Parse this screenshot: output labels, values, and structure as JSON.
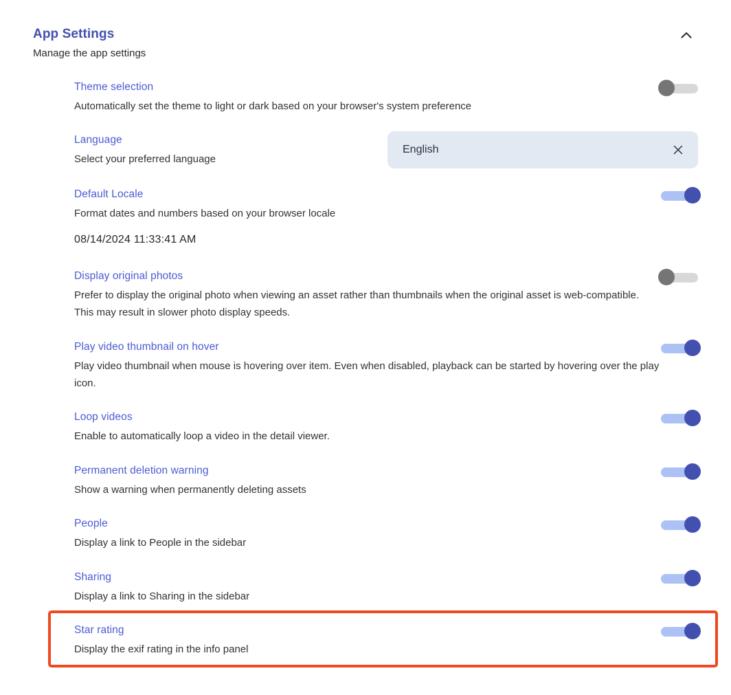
{
  "header": {
    "title": "App Settings",
    "subtitle": "Manage the app settings",
    "collapse_icon": "chevron-up-icon",
    "title_color": "#4250af"
  },
  "colors": {
    "label": "#4b5bd4",
    "description": "#323232",
    "toggle_on_track": "#adc1f5",
    "toggle_on_knob": "#4250af",
    "toggle_off_track": "#d8d8d8",
    "toggle_off_knob": "#757575",
    "select_background": "#e3e9f2",
    "highlight_border": "#f0481f"
  },
  "language_select": {
    "value": "English",
    "clear_icon": "close-icon"
  },
  "settings": [
    {
      "label": "Theme selection",
      "description": "Automatically set the theme to light or dark based on your browser's system preference",
      "control": "toggle",
      "state": "off"
    },
    {
      "label": "Language",
      "description": "Select your preferred language",
      "control": "select",
      "state": "English"
    },
    {
      "label": "Default Locale",
      "description": "Format dates and numbers based on your browser locale",
      "extra": "08/14/2024 11:33:41 AM",
      "control": "toggle",
      "state": "on"
    },
    {
      "label": "Display original photos",
      "description": "Prefer to display the original photo when viewing an asset rather than thumbnails when the original asset is web-compatible. This may result in slower photo display speeds.",
      "control": "toggle",
      "state": "off"
    },
    {
      "label": "Play video thumbnail on hover",
      "description": "Play video thumbnail when mouse is hovering over item. Even when disabled, playback can be started by hovering over the play icon.",
      "control": "toggle",
      "state": "on"
    },
    {
      "label": "Loop videos",
      "description": "Enable to automatically loop a video in the detail viewer.",
      "control": "toggle",
      "state": "on"
    },
    {
      "label": "Permanent deletion warning",
      "description": "Show a warning when permanently deleting assets",
      "control": "toggle",
      "state": "on"
    },
    {
      "label": "People",
      "description": "Display a link to People in the sidebar",
      "control": "toggle",
      "state": "on"
    },
    {
      "label": "Sharing",
      "description": "Display a link to Sharing in the sidebar",
      "control": "toggle",
      "state": "on"
    },
    {
      "label": "Star rating",
      "description": "Display the exif rating in the info panel",
      "control": "toggle",
      "state": "on",
      "highlighted": true
    }
  ]
}
